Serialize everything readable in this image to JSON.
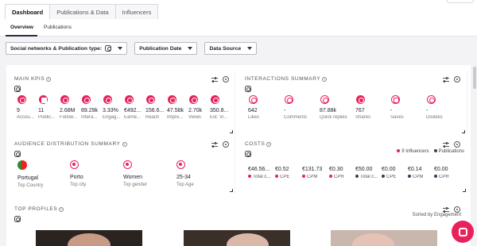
{
  "top_tabs": [
    "Dashboard",
    "Publications & Data",
    "Influencers"
  ],
  "sub_tabs": [
    "Overview",
    "Publications"
  ],
  "filters": {
    "social_networks": "Social networks & Publication type:",
    "publication_date": "Publication Date",
    "data_source": "Data Source"
  },
  "main_kpis": {
    "title": "MAIN KPIs",
    "items": [
      {
        "value": "9",
        "label": "Accou..."
      },
      {
        "value": "11",
        "label": "Public..."
      },
      {
        "value": "2.68M",
        "label": "Follow..."
      },
      {
        "value": "89.29k",
        "label": "Intera..."
      },
      {
        "value": "3.33%",
        "label": "Engag..."
      },
      {
        "value": "€492...",
        "label": "Earne..."
      },
      {
        "value": "156.6...",
        "label": "Reach"
      },
      {
        "value": "47.58k",
        "label": "Impre..."
      },
      {
        "value": "2.70k",
        "label": "Views"
      },
      {
        "value": "350.8...",
        "label": "Est. Vi..."
      }
    ]
  },
  "interactions": {
    "title": "INTERACTIONS SUMMARY",
    "items": [
      {
        "value": "642",
        "label": "Likes"
      },
      {
        "value": "-",
        "label": "Comments"
      },
      {
        "value": "87.88k",
        "label": "Quick replies"
      },
      {
        "value": "767",
        "label": "Shares"
      },
      {
        "value": "-",
        "label": "Saves"
      },
      {
        "value": "-",
        "label": "Dislikes"
      }
    ]
  },
  "audience": {
    "title": "AUDIENCE DISTRIBUTION SUMMARY",
    "items": [
      {
        "value": "Portugal",
        "label": "Top Country"
      },
      {
        "value": "Porto",
        "label": "Top city"
      },
      {
        "value": "Women",
        "label": "Top gender"
      },
      {
        "value": "25-34",
        "label": "Top Age"
      }
    ]
  },
  "costs": {
    "title": "COSTS",
    "legend": [
      "9 Influencers",
      "Publications"
    ],
    "items": [
      {
        "value": "€46.56...",
        "label": "Total c..."
      },
      {
        "value": "€0.52",
        "label": "CPE"
      },
      {
        "value": "€131.73",
        "label": "CPM"
      },
      {
        "value": "€0.30",
        "label": "CPR"
      },
      {
        "value": "€50.00",
        "label": "Total c..."
      },
      {
        "value": "€0.00",
        "label": "CPE"
      },
      {
        "value": "€0.14",
        "label": "CPM"
      },
      {
        "value": "€0.00",
        "label": "CPR"
      }
    ]
  },
  "top_profiles": {
    "title": "TOP PROFILES",
    "sorted_by": "Sorted by Engagement"
  },
  "colors": {
    "accent": "#e8215b",
    "dark_dot": "#3a3a5a"
  },
  "icons": [
    "instagram-icon",
    "info-icon",
    "settings-sliders-icon",
    "gear-icon",
    "chevron-down-icon",
    "chat-icon"
  ]
}
